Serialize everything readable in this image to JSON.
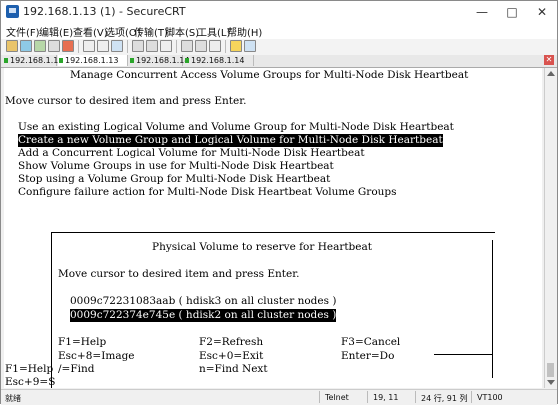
{
  "window": {
    "title": "192.168.1.13 (1) - SecureCRT"
  },
  "menu": [
    "文件(F)",
    "编辑(E)",
    "查看(V)",
    "选项(O)",
    "传输(T)",
    "脚本(S)",
    "工具(L)",
    "帮助(H)"
  ],
  "tabs": [
    "192.168.1.13",
    "192.168.1.13 (1)",
    "192.168.1.14",
    "192.168.1.14 (1)"
  ],
  "terminal": {
    "header": "Manage Concurrent Access Volume Groups for Multi-Node Disk Heartbeat",
    "instruction": "Move cursor to desired item and press Enter.",
    "menu_items": [
      "Use an existing Logical Volume and Volume Group for Multi-Node Disk Heartbeat",
      "Create a new Volume Group and Logical Volume for Multi-Node Disk Heartbeat",
      "Add a Concurrent Logical Volume for Multi-Node Disk Heartbeat",
      "Show Volume Groups in use for Multi-Node Disk Heartbeat",
      "Stop using a Volume Group for Multi-Node Disk Heartbeat",
      "Configure failure action for Multi-Node Disk Heartbeat Volume Groups"
    ],
    "popup": {
      "title": "Physical Volume to reserve for Heartbeat",
      "instruction": "Move cursor to desired item and press Enter.",
      "items": [
        "0009c72231083aab ( hdisk3 on all cluster nodes )",
        "0009c722374e745e ( hdisk2 on all cluster nodes )"
      ],
      "keys_row1": [
        "F1=Help",
        "F2=Refresh",
        "F3=Cancel"
      ],
      "keys_row2": [
        "Esc+8=Image",
        "Esc+0=Exit",
        "Enter=Do"
      ],
      "keys_row3": [
        "/=Find",
        "n=Find Next"
      ]
    },
    "bottom_left_1": "F1=Help",
    "bottom_left_2": "Esc+9=S"
  },
  "status": {
    "ready": "就绪",
    "protocol": "Telnet",
    "cursor": "19,  11",
    "size": "24 行, 91 列",
    "emulation": "VT100"
  }
}
